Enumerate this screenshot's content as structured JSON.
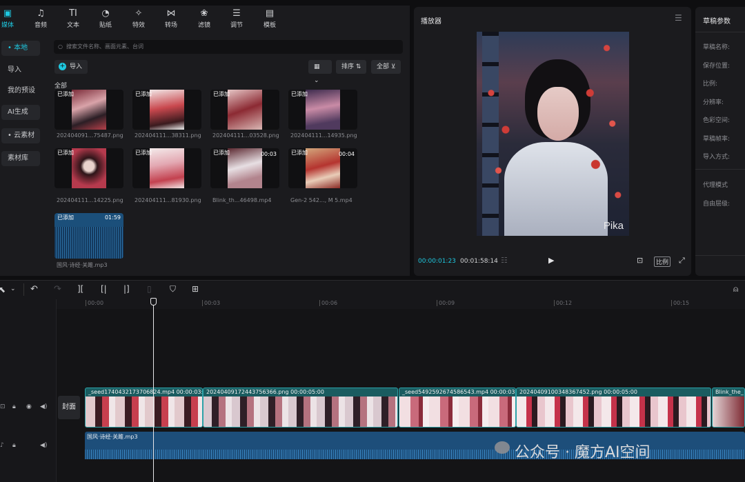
{
  "toolbar": {
    "items": [
      {
        "label": "媒体",
        "icon": "media-icon",
        "glyph": "▣"
      },
      {
        "label": "音频",
        "icon": "audio-icon",
        "glyph": "♫"
      },
      {
        "label": "文本",
        "icon": "text-icon",
        "glyph": "TI"
      },
      {
        "label": "贴纸",
        "icon": "sticker-icon",
        "glyph": "◔"
      },
      {
        "label": "特效",
        "icon": "effects-icon",
        "glyph": "✧"
      },
      {
        "label": "转场",
        "icon": "transition-icon",
        "glyph": "⋈"
      },
      {
        "label": "滤镜",
        "icon": "filter-icon",
        "glyph": "❀"
      },
      {
        "label": "调节",
        "icon": "adjust-icon",
        "glyph": "☰"
      },
      {
        "label": "模板",
        "icon": "template-icon",
        "glyph": "▤"
      }
    ]
  },
  "leftnav": {
    "items": [
      "• 本地",
      "导入",
      "我的预设",
      "AI生成",
      "• 云素材",
      "素材库"
    ]
  },
  "media": {
    "search_placeholder": "搜索文件名称、画面元素、台词",
    "import_label": "导入",
    "sort_label": "排序",
    "filter_label": "全部",
    "section_label": "全部",
    "items": [
      {
        "tag": "已添加",
        "name": "202404091...75487.png",
        "dur": ""
      },
      {
        "tag": "已添加",
        "name": "202404111...38311.png",
        "dur": ""
      },
      {
        "tag": "已添加",
        "name": "202404111...03528.png",
        "dur": ""
      },
      {
        "tag": "已添加",
        "name": "202404111...14935.png",
        "dur": ""
      },
      {
        "tag": "已添加",
        "name": "202404111...14225.png",
        "dur": ""
      },
      {
        "tag": "已添加",
        "name": "202404111...81930.png",
        "dur": ""
      },
      {
        "tag": "已添加",
        "name": "Blink_th...46498.mp4",
        "dur": "00:03"
      },
      {
        "tag": "已添加",
        "name": "Gen-2 542..., M 5.mp4",
        "dur": "00:04"
      },
      {
        "tag": "已添加",
        "name": "国风·诗经·关雎.mp3",
        "dur": "01:59"
      }
    ]
  },
  "player": {
    "title": "播放器",
    "current": "00:00:01:23",
    "total": "00:01:58:14",
    "ratio_label": "比例",
    "watermark": "Pika"
  },
  "params": {
    "title": "草稿参数",
    "rows": [
      "草稿名称:",
      "保存位置:",
      "比例:",
      "分辨率:",
      "色彩空间:",
      "草稿帧率:",
      "导入方式:",
      "代理模式",
      "自由层级:"
    ]
  },
  "timeline": {
    "ruler": [
      "00:00",
      "00:03",
      "00:06",
      "00:09",
      "00:12",
      "00:15"
    ],
    "cover_label": "封面",
    "clips": [
      {
        "name": "_seed1740432173706824.mp4",
        "dur": "00:00:03:0"
      },
      {
        "name": "20240409172443756366.png",
        "dur": "00:00:05:00"
      },
      {
        "name": "_seed5492592674586543.mp4",
        "dur": "00:00:03:0"
      },
      {
        "name": "20240409100348367452.png",
        "dur": "00:00:05:00"
      },
      {
        "name": "Blink_the_",
        "dur": ""
      }
    ],
    "audio_clip": "国风·诗经·关雎.mp3"
  },
  "watermark_text": "公众号 · 魔方AI空间",
  "colors": {
    "accent": "#1ec8e0",
    "clip": "#1a5c60",
    "audio": "#1d4e7a"
  }
}
